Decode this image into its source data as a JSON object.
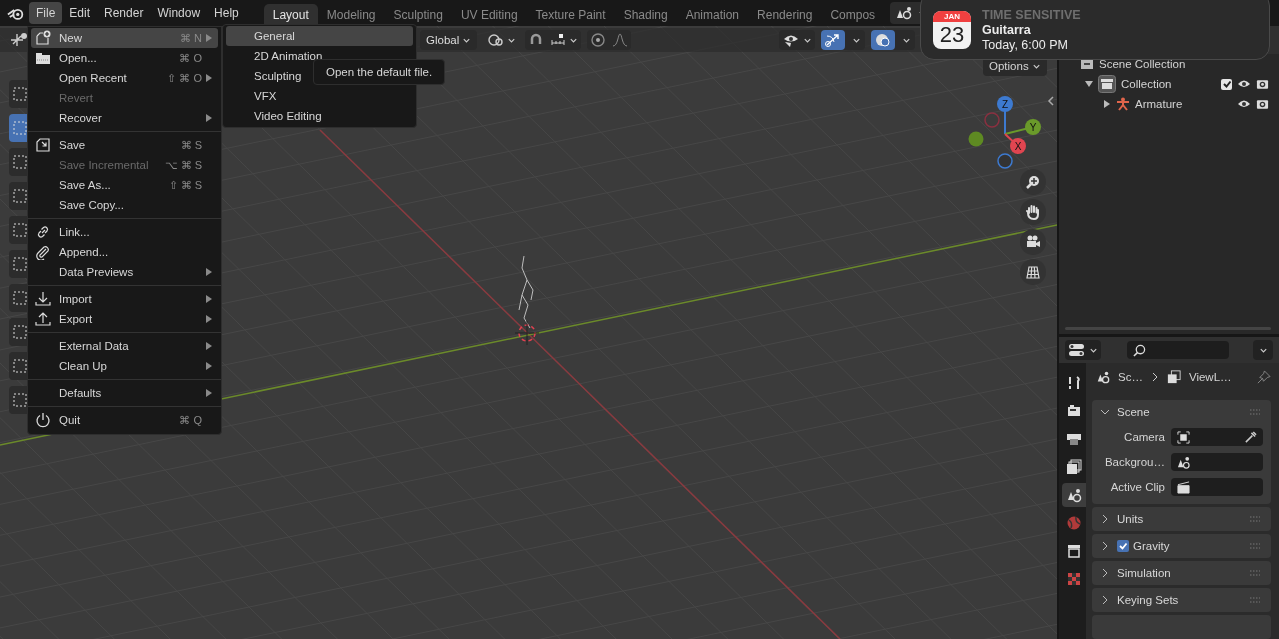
{
  "menubar": {
    "items": [
      {
        "label": "File",
        "selected": true
      },
      {
        "label": "Edit",
        "selected": false
      },
      {
        "label": "Render",
        "selected": false
      },
      {
        "label": "Window",
        "selected": false
      },
      {
        "label": "Help",
        "selected": false
      }
    ]
  },
  "workspace_tabs": [
    {
      "label": "Layout",
      "selected": true
    },
    {
      "label": "Modeling",
      "selected": false
    },
    {
      "label": "Sculpting",
      "selected": false
    },
    {
      "label": "UV Editing",
      "selected": false
    },
    {
      "label": "Texture Paint",
      "selected": false
    },
    {
      "label": "Shading",
      "selected": false
    },
    {
      "label": "Animation",
      "selected": false
    },
    {
      "label": "Rendering",
      "selected": false
    },
    {
      "label": "Compos",
      "selected": false
    }
  ],
  "toolbar": {
    "tools": [
      {
        "selected": false
      },
      {
        "selected": true
      },
      {
        "selected": false
      },
      {
        "selected": false
      },
      {
        "selected": false
      },
      {
        "selected": false
      },
      {
        "selected": false
      },
      {
        "selected": false
      },
      {
        "selected": false
      },
      {
        "selected": false
      }
    ]
  },
  "viewport_header": {
    "orientation": "Global",
    "gizmos_on": true,
    "overlays_on": true
  },
  "viewport": {
    "options": "Options",
    "gizmo_axes": [
      "Z",
      "Y",
      "X"
    ]
  },
  "file_menu": {
    "groups": [
      [
        {
          "label": "New",
          "shortcut": "⌘ N",
          "submenu": true,
          "disabled": false,
          "selected": true
        },
        {
          "label": "Open...",
          "shortcut": "⌘ O",
          "submenu": false,
          "disabled": false,
          "selected": false
        },
        {
          "label": "Open Recent",
          "shortcut": "⇧ ⌘ O",
          "submenu": true,
          "disabled": false,
          "selected": false
        },
        {
          "label": "Revert",
          "submenu": false,
          "disabled": true,
          "selected": false
        },
        {
          "label": "Recover",
          "submenu": true,
          "disabled": false,
          "selected": false
        }
      ],
      [
        {
          "label": "Save",
          "shortcut": "⌘ S",
          "submenu": false,
          "disabled": false,
          "selected": false
        },
        {
          "label": "Save Incremental",
          "shortcut": "⌥ ⌘ S",
          "submenu": false,
          "disabled": true,
          "selected": false
        },
        {
          "label": "Save As...",
          "shortcut": "⇧ ⌘ S",
          "submenu": false,
          "disabled": false,
          "selected": false
        },
        {
          "label": "Save Copy...",
          "submenu": false,
          "disabled": false,
          "selected": false
        }
      ],
      [
        {
          "label": "Link...",
          "submenu": false,
          "disabled": false,
          "selected": false
        },
        {
          "label": "Append...",
          "submenu": false,
          "disabled": false,
          "selected": false
        },
        {
          "label": "Data Previews",
          "submenu": true,
          "disabled": false,
          "selected": false
        }
      ],
      [
        {
          "label": "Import",
          "submenu": true,
          "disabled": false,
          "selected": false
        },
        {
          "label": "Export",
          "submenu": true,
          "disabled": false,
          "selected": false
        }
      ],
      [
        {
          "label": "External Data",
          "submenu": true,
          "disabled": false,
          "selected": false
        },
        {
          "label": "Clean Up",
          "submenu": true,
          "disabled": false,
          "selected": false
        }
      ],
      [
        {
          "label": "Defaults",
          "submenu": true,
          "disabled": false,
          "selected": false
        }
      ],
      [
        {
          "label": "Quit",
          "shortcut": "⌘ Q",
          "submenu": false,
          "disabled": false,
          "selected": false
        }
      ]
    ]
  },
  "new_submenu": {
    "items": [
      {
        "label": "General",
        "selected": true
      },
      {
        "label": "2D Animation",
        "selected": false
      },
      {
        "label": "Sculpting",
        "selected": false
      },
      {
        "label": "VFX",
        "selected": false
      },
      {
        "label": "Video Editing",
        "selected": false
      }
    ]
  },
  "tooltip": "Open the default file.",
  "notification": {
    "month": "JAN",
    "day": "23",
    "category": "TIME SENSITIVE",
    "title": "Guitarra",
    "time": "Today, 6:00 PM"
  },
  "outliner": {
    "items": [
      {
        "label": "Scene Collection",
        "children": [
          {
            "label": "Collection",
            "expanded": true,
            "checked": true,
            "children": [
              {
                "label": "Armature",
                "expanded": false
              }
            ]
          }
        ]
      }
    ]
  },
  "properties": {
    "tabs": [
      {
        "selected": false
      },
      {
        "selected": false
      },
      {
        "selected": false
      },
      {
        "selected": false
      },
      {
        "selected": true
      },
      {
        "selected": false
      },
      {
        "selected": false
      },
      {
        "selected": false
      }
    ],
    "breadcrumb": [
      "Sc…",
      "ViewL…"
    ],
    "panels": [
      {
        "title": "Scene",
        "expanded": true,
        "fields": [
          {
            "label": "Camera"
          },
          {
            "label": "Backgrou…"
          },
          {
            "label": "Active Clip"
          }
        ]
      },
      {
        "title": "Units",
        "expanded": false
      },
      {
        "title": "Gravity",
        "expanded": false,
        "checked": true
      },
      {
        "title": "Simulation",
        "expanded": false
      },
      {
        "title": "Keying Sets",
        "expanded": false
      }
    ]
  }
}
